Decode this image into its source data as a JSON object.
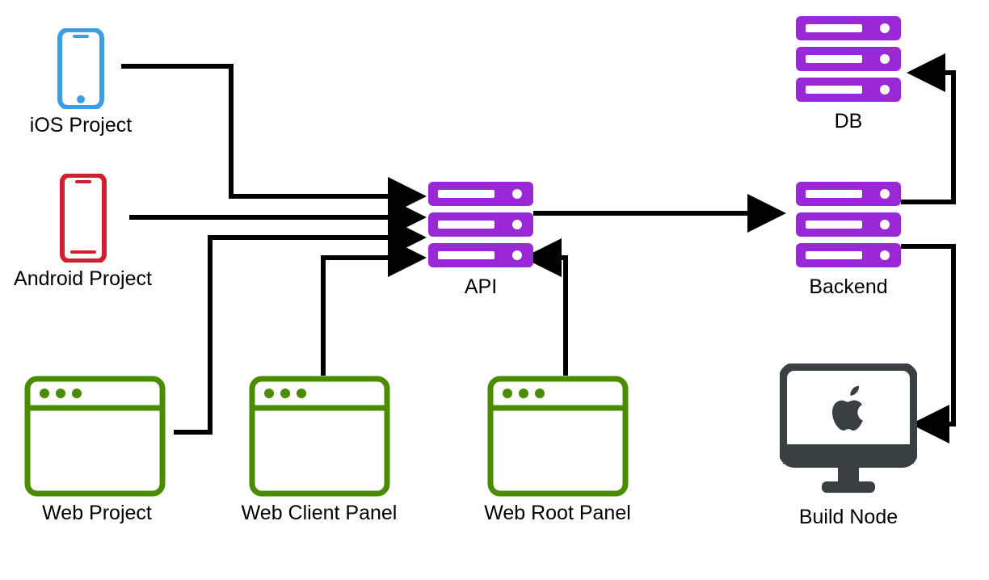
{
  "nodes": {
    "ios": {
      "label": "iOS Project"
    },
    "android": {
      "label": "Android Project"
    },
    "web": {
      "label": "Web Project"
    },
    "client_panel": {
      "label": "Web Client Panel"
    },
    "root_panel": {
      "label": "Web Root Panel"
    },
    "api": {
      "label": "API"
    },
    "db": {
      "label": "DB"
    },
    "backend": {
      "label": "Backend"
    },
    "build_node": {
      "label": "Build Node"
    }
  },
  "edges": [
    {
      "from": "ios",
      "to": "api",
      "dir": "forward"
    },
    {
      "from": "android",
      "to": "api",
      "dir": "forward"
    },
    {
      "from": "web",
      "to": "api",
      "dir": "forward"
    },
    {
      "from": "client_panel",
      "to": "api",
      "dir": "forward"
    },
    {
      "from": "root_panel",
      "to": "api",
      "dir": "back"
    },
    {
      "from": "api",
      "to": "backend",
      "dir": "forward"
    },
    {
      "from": "backend",
      "to": "db",
      "dir": "forward"
    },
    {
      "from": "backend",
      "to": "build_node",
      "dir": "forward"
    }
  ],
  "colors": {
    "ios": "#3C9FE3",
    "android": "#D11F2F",
    "web": "#4B8B00",
    "server": "#9A28D6",
    "build": "#3A3F42"
  }
}
